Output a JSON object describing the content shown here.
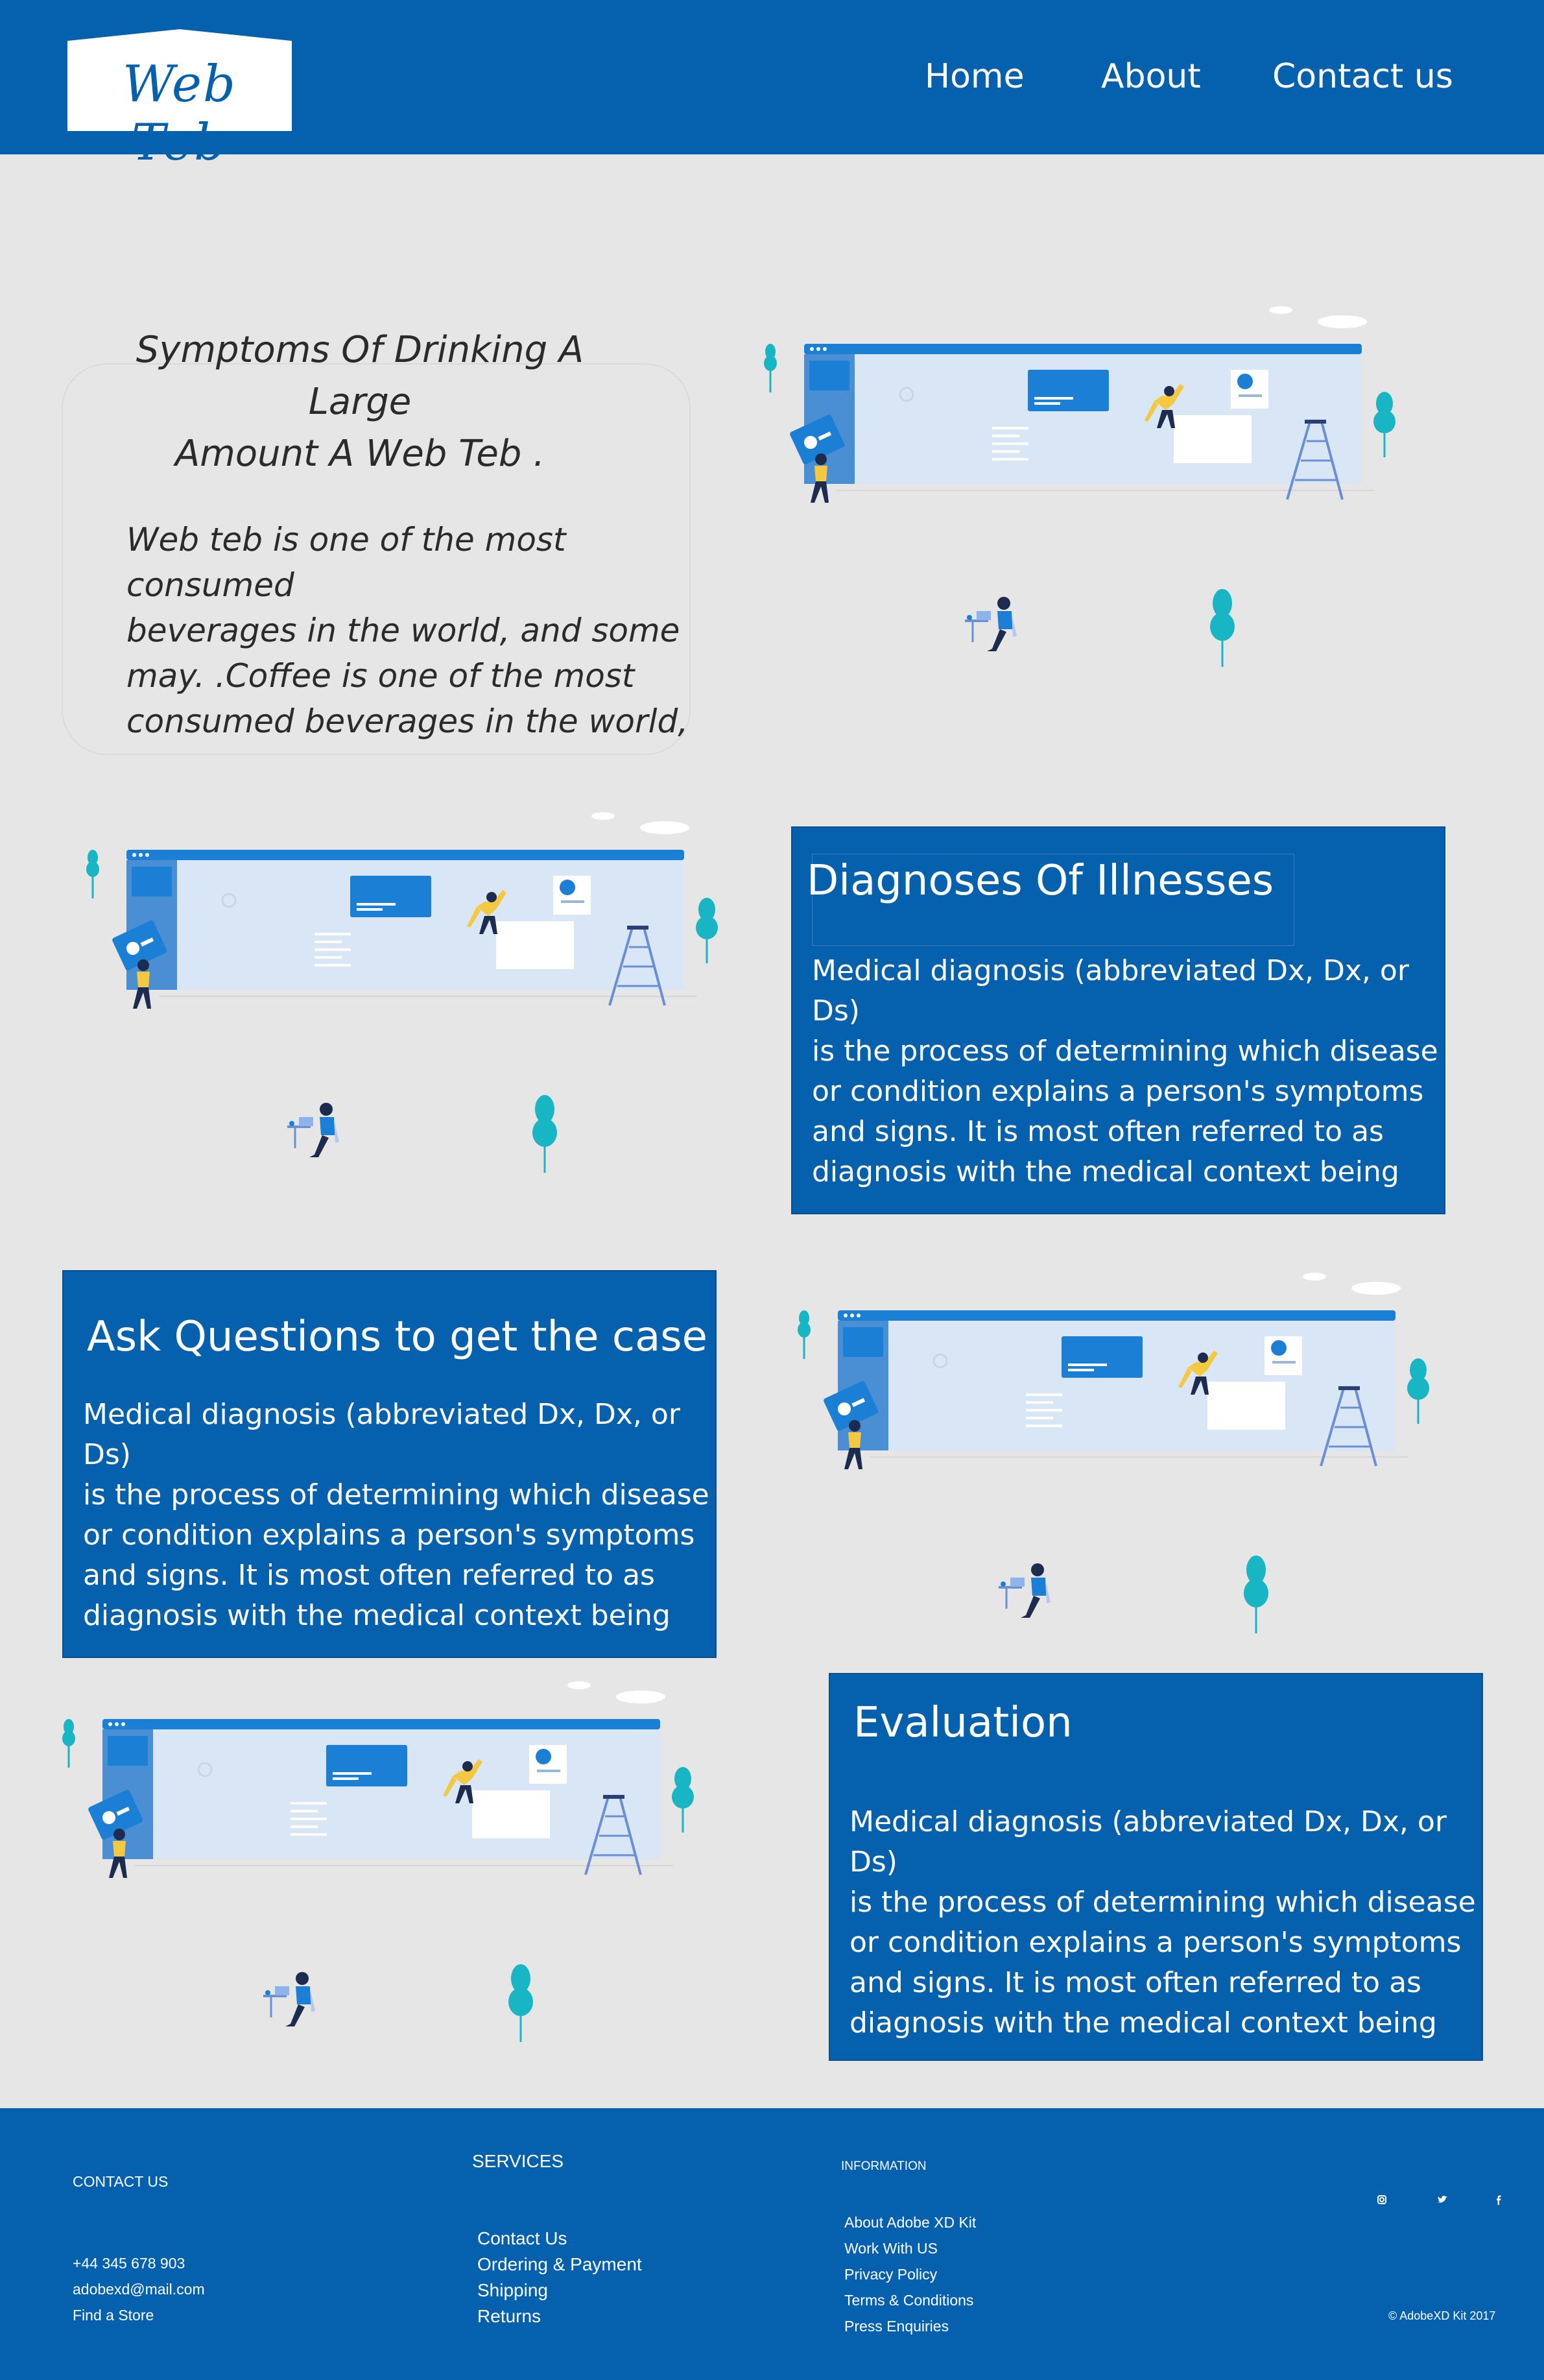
{
  "brand": {
    "logo_text": "Web Teb"
  },
  "nav": {
    "home": "Home",
    "about": "About",
    "contact": "Contact us"
  },
  "intro": {
    "title_line1": "Symptoms Of Drinking A Large",
    "title_line2": "Amount A Web Teb .",
    "body_lines": [
      "Web teb  is one of the most consumed",
      "beverages in the world, and some",
      "may. .Coffee is one of the most",
      "consumed beverages in the world,"
    ]
  },
  "sections": [
    {
      "title": "Diagnoses Of Illnesses",
      "body_lines": [
        "Medical diagnosis (abbreviated Dx, Dx, or Ds)",
        "is the process of determining which disease",
        "or condition explains a person's symptoms",
        "and signs. It is most often referred to as",
        "diagnosis with the medical context being"
      ]
    },
    {
      "title": "Ask Questions to get the case",
      "body_lines": [
        "Medical diagnosis (abbreviated Dx, Dx, or Ds)",
        "is the process of determining which disease",
        "or condition explains a person's symptoms",
        "and signs. It is most often referred to as",
        "diagnosis with the medical context being"
      ]
    },
    {
      "title": "Evaluation",
      "body_lines": [
        "Medical diagnosis (abbreviated Dx, Dx, or Ds)",
        "is the process of determining which disease",
        "or condition explains a person's symptoms",
        "and signs. It is most often referred to as",
        "diagnosis with the medical context being"
      ]
    }
  ],
  "footer": {
    "contact_heading": "CONTACT US",
    "phone": "+44 345 678 903",
    "email": "adobexd@mail.com",
    "find_store": "Find a Store",
    "services_heading": "SERVICES",
    "services": [
      "Contact Us",
      "Ordering & Payment",
      "Shipping",
      "Returns"
    ],
    "info_heading": "INFORMATION",
    "info": [
      "About Adobe XD Kit",
      "Work With US",
      "Privacy Policy",
      "Terms & Conditions",
      "Press Enquiries"
    ],
    "social_icons": [
      "instagram-icon",
      "twitter-icon",
      "facebook-icon"
    ],
    "copyright": "© AdobeXD Kit 2017"
  },
  "colors": {
    "primary": "#0561ad",
    "background": "#e6e6e6",
    "accent_teal": "#18b5c4",
    "figure_yellow": "#f5c842"
  }
}
